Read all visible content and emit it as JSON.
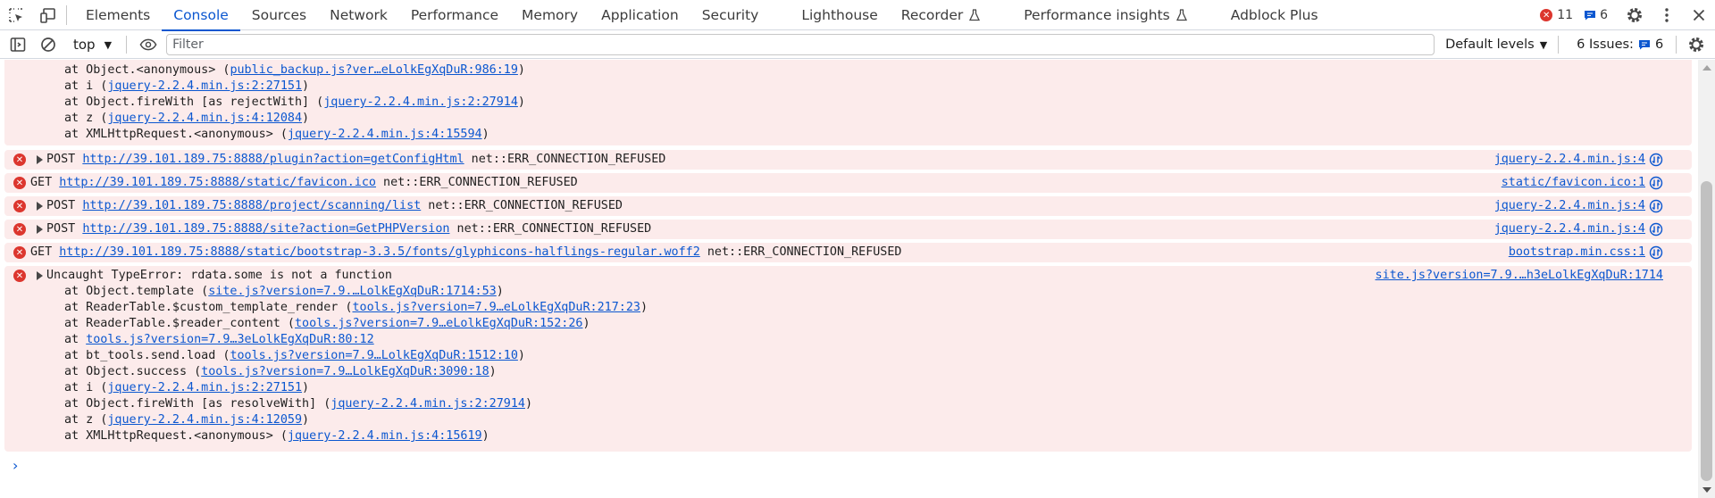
{
  "tabs": [
    {
      "label": "Elements"
    },
    {
      "label": "Console"
    },
    {
      "label": "Sources"
    },
    {
      "label": "Network"
    },
    {
      "label": "Performance"
    },
    {
      "label": "Memory"
    },
    {
      "label": "Application"
    },
    {
      "label": "Security"
    },
    {
      "label": "Lighthouse"
    },
    {
      "label": "Recorder"
    },
    {
      "label": "Performance insights"
    },
    {
      "label": "Adblock Plus"
    }
  ],
  "active_tab": "Console",
  "header": {
    "error_count": "11",
    "message_count": "6"
  },
  "toolbar": {
    "context": "top",
    "filter_placeholder": "Filter",
    "levels": "Default levels",
    "issues_label": "6 Issues:",
    "issues_count": "6"
  },
  "colors": {
    "accent": "#0b57d0",
    "error_bg": "#fcebeb",
    "error_icon": "#dc362e"
  },
  "messages": [
    {
      "stack": [
        {
          "pre": "at Object.<anonymous> (",
          "link": "public_backup.js?ver…eLolkEgXqDuR:986:19",
          "post": ")"
        },
        {
          "pre": "at i (",
          "link": "jquery-2.2.4.min.js:2:27151",
          "post": ")"
        },
        {
          "pre": "at Object.fireWith [as rejectWith] (",
          "link": "jquery-2.2.4.min.js:2:27914",
          "post": ")"
        },
        {
          "pre": "at z (",
          "link": "jquery-2.2.4.min.js:4:12084",
          "post": ")"
        },
        {
          "pre": "at XMLHttpRequest.<anonymous> (",
          "link": "jquery-2.2.4.min.js:4:15594",
          "post": ")"
        }
      ]
    },
    {
      "method": "POST",
      "url": "http://39.101.189.75:8888/plugin?action=getConfigHtml",
      "error": "net::ERR_CONNECTION_REFUSED",
      "source": "jquery-2.2.4.min.js:4",
      "expandable": true
    },
    {
      "method": "GET",
      "url": "http://39.101.189.75:8888/static/favicon.ico",
      "error": "net::ERR_CONNECTION_REFUSED",
      "source": "static/favicon.ico:1",
      "expandable": false
    },
    {
      "method": "POST",
      "url": "http://39.101.189.75:8888/project/scanning/list",
      "error": "net::ERR_CONNECTION_REFUSED",
      "source": "jquery-2.2.4.min.js:4",
      "expandable": true
    },
    {
      "method": "POST",
      "url": "http://39.101.189.75:8888/site?action=GetPHPVersion",
      "error": "net::ERR_CONNECTION_REFUSED",
      "source": "jquery-2.2.4.min.js:4",
      "expandable": true
    },
    {
      "method": "GET",
      "url": "http://39.101.189.75:8888/static/bootstrap-3.3.5/fonts/glyphicons-halflings-regular.woff2",
      "error": "net::ERR_CONNECTION_REFUSED",
      "source": "bootstrap.min.css:1",
      "expandable": false
    },
    {
      "title": "Uncaught TypeError: rdata.some is not a function",
      "source": "site.js?version=7.9.…h3eLolkEgXqDuR:1714",
      "stack": [
        {
          "pre": "at Object.template (",
          "link": "site.js?version=7.9.…LolkEgXqDuR:1714:53",
          "post": ")"
        },
        {
          "pre": "at ReaderTable.$custom_template_render (",
          "link": "tools.js?version=7.9…eLolkEgXqDuR:217:23",
          "post": ")"
        },
        {
          "pre": "at ReaderTable.$reader_content (",
          "link": "tools.js?version=7.9…eLolkEgXqDuR:152:26",
          "post": ")"
        },
        {
          "pre": "at ",
          "link": "tools.js?version=7.9…3eLolkEgXqDuR:80:12",
          "post": ""
        },
        {
          "pre": "at bt_tools.send.load (",
          "link": "tools.js?version=7.9…LolkEgXqDuR:1512:10",
          "post": ")"
        },
        {
          "pre": "at Object.success (",
          "link": "tools.js?version=7.9…LolkEgXqDuR:3090:18",
          "post": ")"
        },
        {
          "pre": "at i (",
          "link": "jquery-2.2.4.min.js:2:27151",
          "post": ")"
        },
        {
          "pre": "at Object.fireWith [as resolveWith] (",
          "link": "jquery-2.2.4.min.js:2:27914",
          "post": ")"
        },
        {
          "pre": "at z (",
          "link": "jquery-2.2.4.min.js:4:12059",
          "post": ")"
        },
        {
          "pre": "at XMLHttpRequest.<anonymous> (",
          "link": "jquery-2.2.4.min.js:4:15619",
          "post": ")"
        }
      ]
    }
  ],
  "prompt_symbol": "›"
}
